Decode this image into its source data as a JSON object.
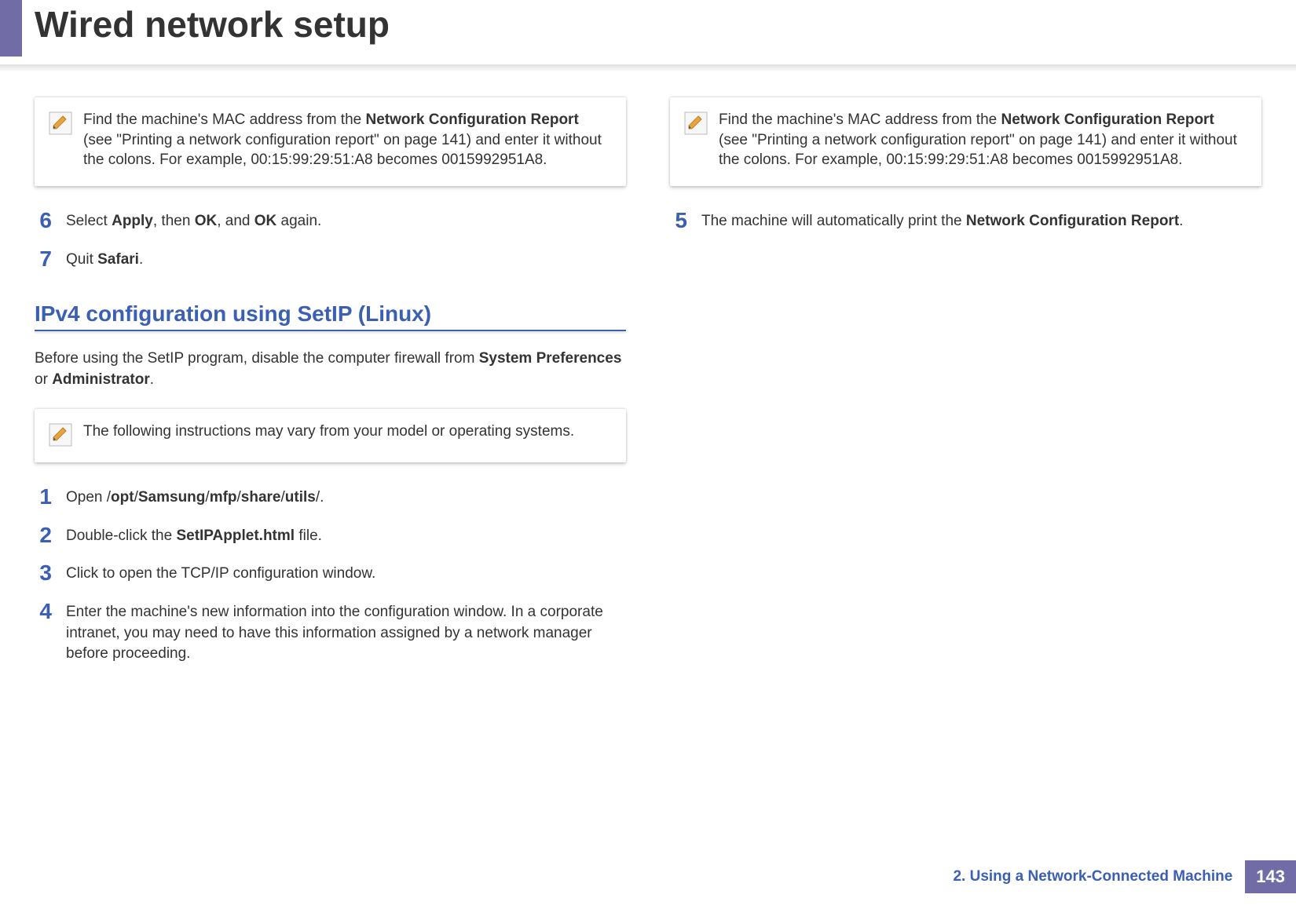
{
  "header": {
    "title": "Wired network setup"
  },
  "left": {
    "note1_pre": "Find the machine's MAC address from the ",
    "note1_bold1": "Network Configuration Report",
    "note1_post": " (see \"Printing a network configuration report\" on page 141) and enter it without the colons. For example, 00:15:99:29:51:A8 becomes 0015992951A8.",
    "step6_num": "6",
    "step6_a": "Select ",
    "step6_b1": "Apply",
    "step6_b": ", then ",
    "step6_b2": "OK",
    "step6_c": ", and ",
    "step6_b3": "OK",
    "step6_d": " again.",
    "step7_num": "7",
    "step7_a": "Quit ",
    "step7_b1": "Safari",
    "step7_b": ".",
    "section_heading": "IPv4 configuration using SetIP (Linux)",
    "section_para_a": "Before using the SetIP program, disable the computer firewall from ",
    "section_para_b1": "System Preferences",
    "section_para_b": " or ",
    "section_para_b2": "Administrator",
    "section_para_c": ".",
    "note2_text": "The following instructions may vary from your model or operating systems.",
    "lstep1_num": "1",
    "lstep1_a": "Open /",
    "lstep1_b1": "opt",
    "lstep1_s1": "/",
    "lstep1_b2": "Samsung",
    "lstep1_s2": "/",
    "lstep1_b3": "mfp",
    "lstep1_s3": "/",
    "lstep1_b4": "share",
    "lstep1_s4": "/",
    "lstep1_b5": "utils",
    "lstep1_s5": "/.",
    "lstep2_num": "2",
    "lstep2_a": "Double-click the ",
    "lstep2_b1": "SetIPApplet.html",
    "lstep2_b": " file.",
    "lstep3_num": "3",
    "lstep3_text": "Click to open the TCP/IP configuration window.",
    "lstep4_num": "4",
    "lstep4_text": "Enter the machine's new information into the configuration window. In a corporate intranet, you may need to have this information assigned by a network manager before proceeding."
  },
  "right": {
    "note1_pre": "Find the machine's MAC address from the ",
    "note1_bold1": "Network Configuration Report",
    "note1_post": " (see \"Printing a network configuration report\" on page 141) and enter it without the colons. For example, 00:15:99:29:51:A8 becomes 0015992951A8.",
    "step5_num": "5",
    "step5_a": "The machine will automatically print the ",
    "step5_b1": "Network Configuration Report",
    "step5_b": "."
  },
  "footer": {
    "chapter": "2.  Using a Network-Connected Machine",
    "page": "143"
  }
}
